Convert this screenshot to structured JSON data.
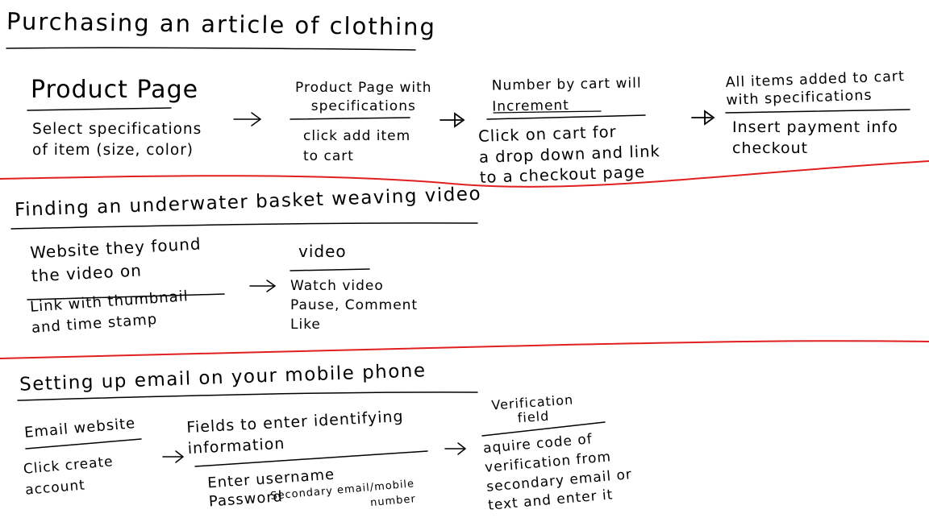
{
  "colors": {
    "ink": "#000000",
    "divider": "#e02020",
    "background": "#ffffff"
  },
  "scenarios": [
    {
      "title": "Purchasing an article of clothing",
      "steps": [
        {
          "heading": "Product Page",
          "actions": "Select specifications\nof item (size, color)"
        },
        {
          "heading": "Product Page with\nspecifications",
          "actions": "click add item\nto cart"
        },
        {
          "heading": "Number by cart will\nIncrement",
          "actions": "Click on cart for\na drop down and link\nto a checkout page"
        },
        {
          "heading": "All items added to cart\nwith specifications",
          "actions": "Insert payment info\ncheckout"
        }
      ]
    },
    {
      "title": "Finding an underwater basket weaving video",
      "steps": [
        {
          "heading": "Website they found\nthe video on",
          "actions": "Link with thumbnail\nand time stamp"
        },
        {
          "heading": "video",
          "actions": "Watch video\nPause, Comment\nLike"
        }
      ]
    },
    {
      "title": "Setting up email on your mobile phone",
      "steps": [
        {
          "heading": "Email website",
          "actions": "Click create\naccount"
        },
        {
          "heading": "Fields to enter identifying\ninformation",
          "actions": "Enter username\nPassword",
          "extra": "Secondary email/mobile\nnumber"
        },
        {
          "heading": "Verification\nfield",
          "actions": "aquire code of\nverification from\nsecondary email or\ntext and enter it"
        }
      ]
    }
  ]
}
